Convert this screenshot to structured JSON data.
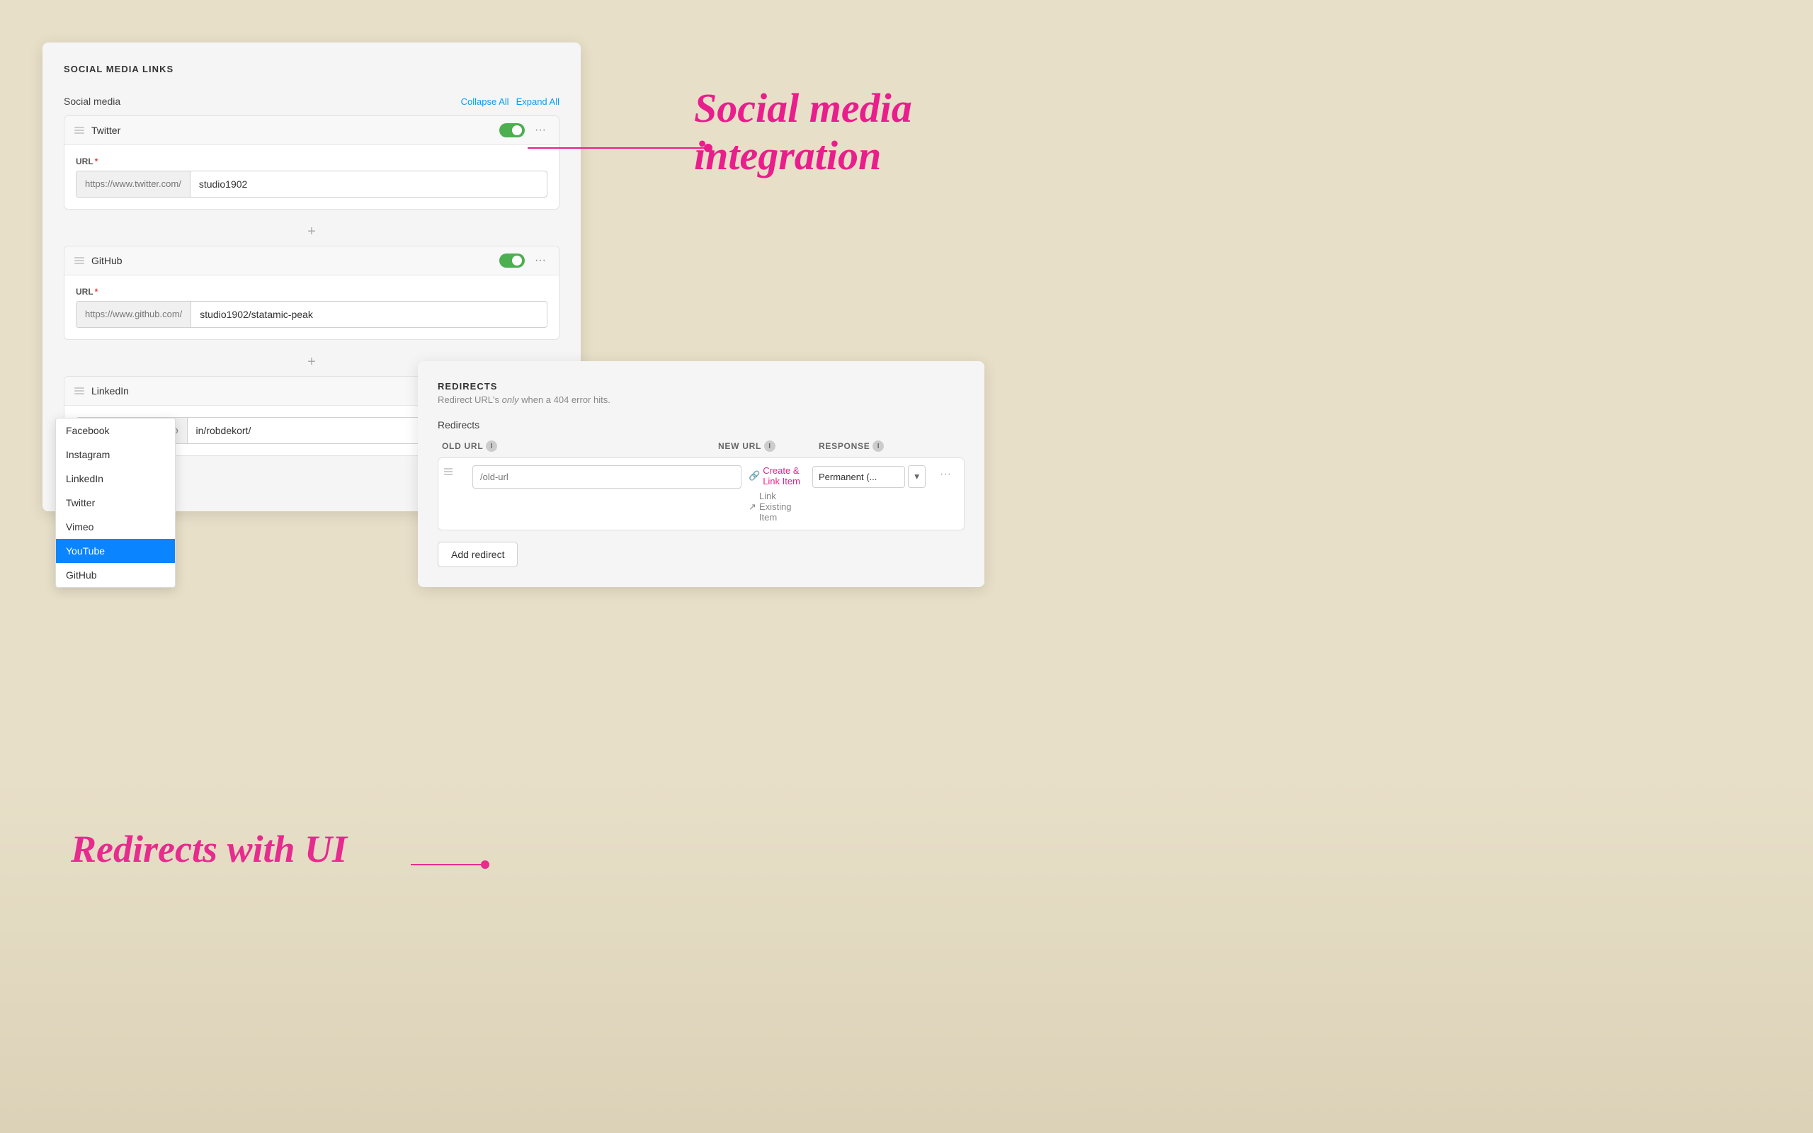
{
  "social_panel": {
    "title": "SOCIAL MEDIA LINKS",
    "section_label": "Social media",
    "collapse_all": "Collapse All",
    "expand_all": "Expand All",
    "items": [
      {
        "name": "Twitter",
        "enabled": true,
        "url_label": "URL",
        "url_prefix": "https://www.twitter.com/",
        "url_value": "studio1902"
      },
      {
        "name": "GitHub",
        "enabled": true,
        "url_label": "URL",
        "url_prefix": "https://www.github.com/",
        "url_value": "studio1902/statamic-peak"
      },
      {
        "name": "LinkedIn",
        "enabled": true,
        "url_label": "URL",
        "url_prefix": "https://www.linkedin.com/",
        "url_value": "in/robdekort/"
      }
    ],
    "add_label": "+"
  },
  "dropdown": {
    "items": [
      {
        "label": "Facebook",
        "selected": false
      },
      {
        "label": "Instagram",
        "selected": false
      },
      {
        "label": "LinkedIn",
        "selected": false
      },
      {
        "label": "Twitter",
        "selected": false
      },
      {
        "label": "Vimeo",
        "selected": false
      },
      {
        "label": "YouTube",
        "selected": true
      },
      {
        "label": "GitHub",
        "selected": false
      }
    ]
  },
  "redirects_panel": {
    "title": "REDIRECTS",
    "subtitle": "Redirect URL's only when a 404 error hits.",
    "section_label": "Redirects",
    "columns": {
      "old_url": "OLD URL",
      "new_url": "NEW URL",
      "response": "RESPONSE"
    },
    "row": {
      "old_url_placeholder": "/old-url",
      "create_link_label": "Create & Link Item",
      "link_existing_label": "Link Existing Item",
      "response_value": "Permanent (..."
    },
    "add_redirect_label": "Add redirect"
  },
  "annotations": {
    "social": "Social media\nintegration",
    "social_line1": "Social media",
    "social_line2": "integration",
    "redirects": "Redirects with UI"
  }
}
